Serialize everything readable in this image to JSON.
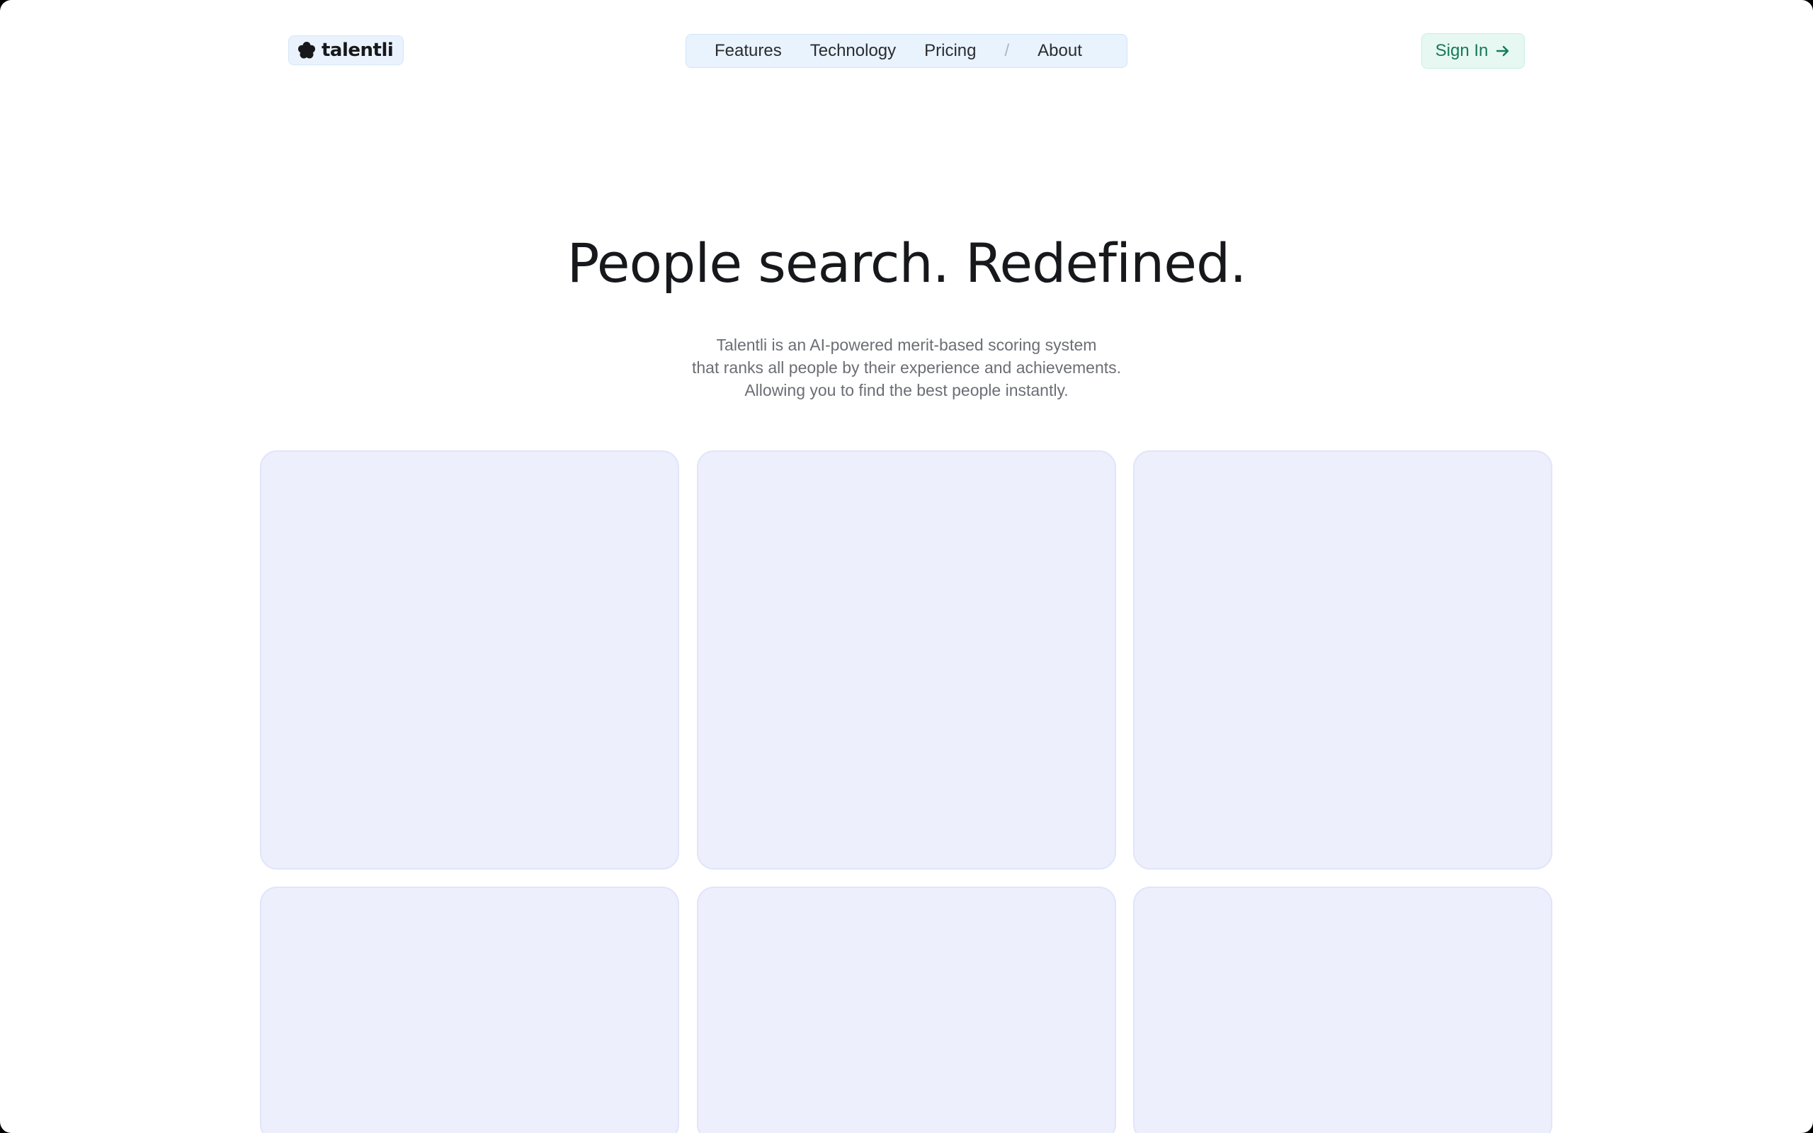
{
  "brand": {
    "name": "talentli",
    "logo_icon": "flower-icon"
  },
  "nav": {
    "items": [
      "Features",
      "Technology",
      "Pricing",
      "About"
    ],
    "separator": "/"
  },
  "signin": {
    "label": "Sign In",
    "icon": "arrow-right-icon"
  },
  "hero": {
    "title": "People search. Redefined.",
    "subtitle_lines": [
      "Talentli is an AI-powered merit-based scoring system",
      "that ranks all people by their experience and achievements.",
      "Allowing you to find the best people instantly."
    ]
  },
  "colors": {
    "accent_green": "#167a5a",
    "nav_bg": "#e9f3fd",
    "card_bg": "#edeffd",
    "text_dark": "#17181b",
    "text_muted": "#6b6e74"
  }
}
